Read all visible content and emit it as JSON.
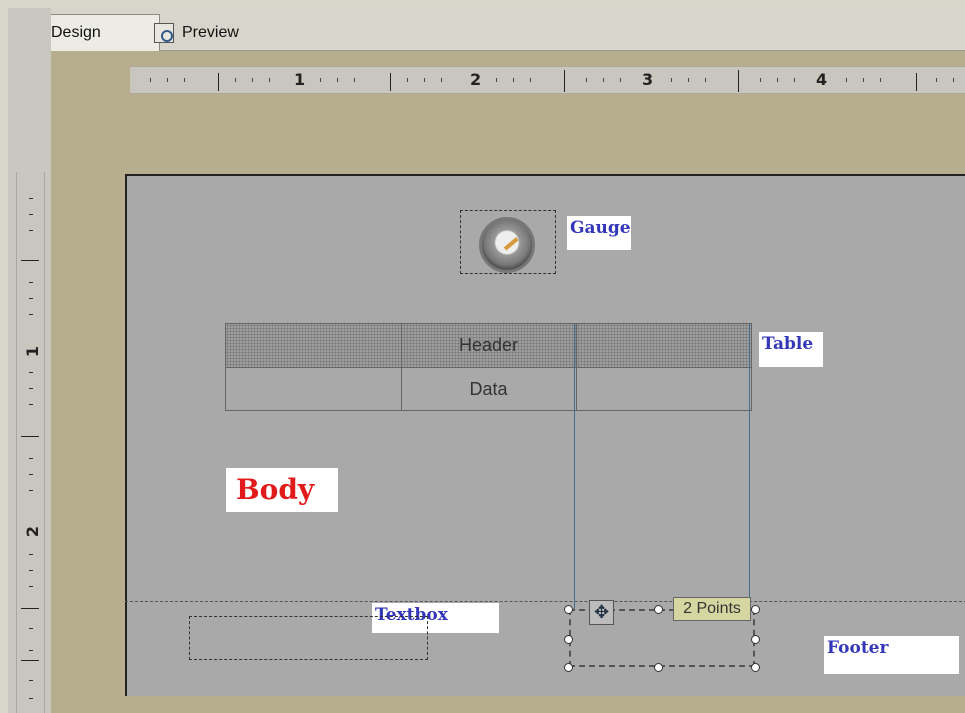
{
  "tabs": [
    {
      "label": "Design"
    },
    {
      "label": "Preview"
    }
  ],
  "ruler": {
    "horizontal_labels": [
      "1",
      "2",
      "3",
      "4"
    ],
    "vertical_labels": [
      "1",
      "2"
    ]
  },
  "design": {
    "gauge_label": "Gauge",
    "table_label": "Table",
    "body_label": "Body",
    "textbox_label": "Textbox",
    "footer_label": "Footer",
    "table": {
      "header": "Header",
      "data": "Data"
    },
    "selection_label": "2 Points"
  }
}
